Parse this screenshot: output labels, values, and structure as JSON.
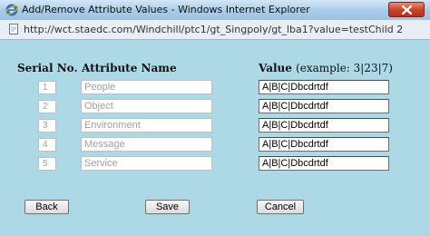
{
  "window": {
    "title": "Add/Remove Attribute Values - Windows Internet Explorer",
    "url": "http://wct.staedc.com/Windchill/ptc1/gt_Singpoly/gt_lba1?value=testChild 2"
  },
  "table": {
    "headers": {
      "serial": "Serial No.",
      "attribute": "Attribute Name",
      "value": "Value",
      "value_example": "(example: 3|23|7)"
    },
    "rows": [
      {
        "serial": "1",
        "attribute": "People",
        "value": "A|B|C|Dbcdrtdf"
      },
      {
        "serial": "2",
        "attribute": "Object",
        "value": "A|B|C|Dbcdrtdf"
      },
      {
        "serial": "3",
        "attribute": "Environment",
        "value": "A|B|C|Dbcdrtdf"
      },
      {
        "serial": "4",
        "attribute": "Message",
        "value": "A|B|C|Dbcdrtdf"
      },
      {
        "serial": "5",
        "attribute": "Service",
        "value": "A|B|C|Dbcdrtdf"
      }
    ]
  },
  "buttons": {
    "back": "Back",
    "save": "Save",
    "cancel": "Cancel"
  },
  "icons": {
    "browser": "internet-explorer-icon",
    "page": "page-icon",
    "close": "close-icon"
  }
}
